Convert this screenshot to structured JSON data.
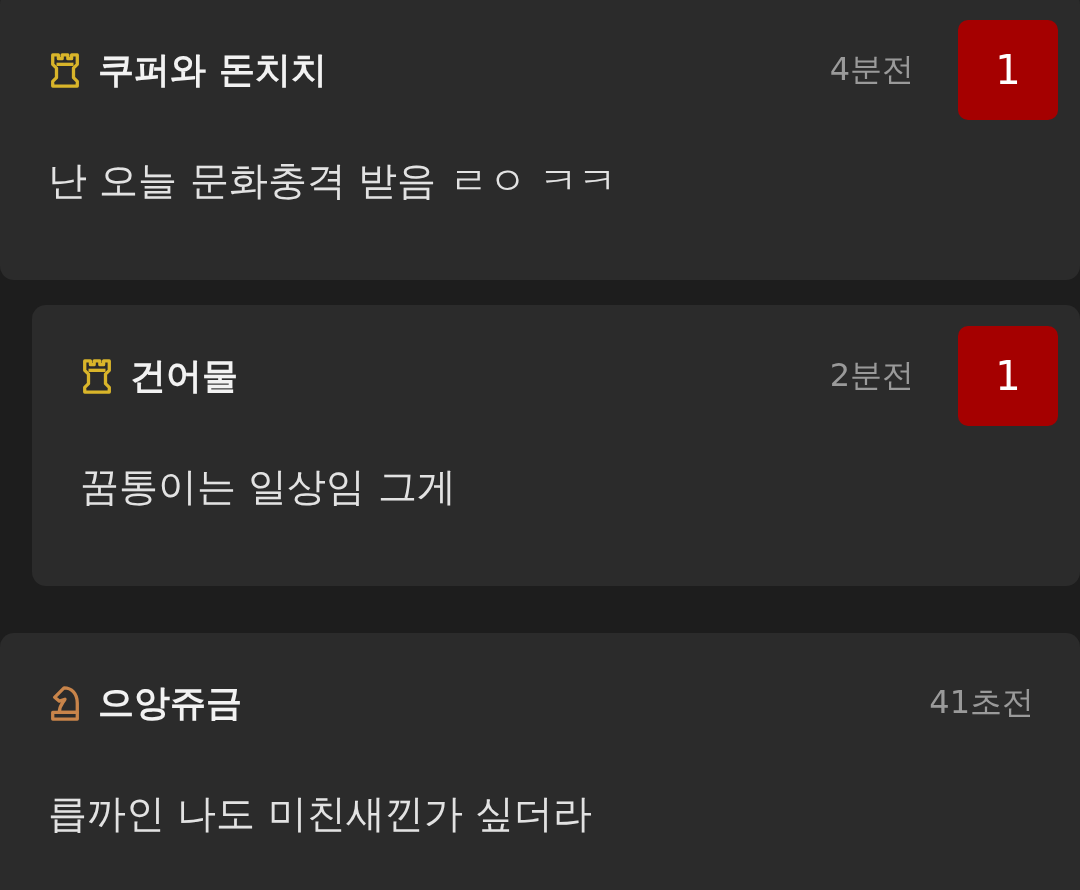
{
  "comments": [
    {
      "kind": "rook",
      "name": "쿠퍼와 돈치치",
      "time": "4분전",
      "badge": "1",
      "message": "난 오늘 문화충격 받음 ㄹㅇ ㅋㅋ",
      "children": [
        {
          "kind": "rook",
          "name": "건어물",
          "time": "2분전",
          "badge": "1",
          "message": "꿈통이는 일상임 그게"
        }
      ]
    },
    {
      "kind": "knight",
      "name": "으앙쥬금",
      "time": "41초전",
      "message": "릅까인 나도 미친새낀가 싶더라"
    }
  ]
}
